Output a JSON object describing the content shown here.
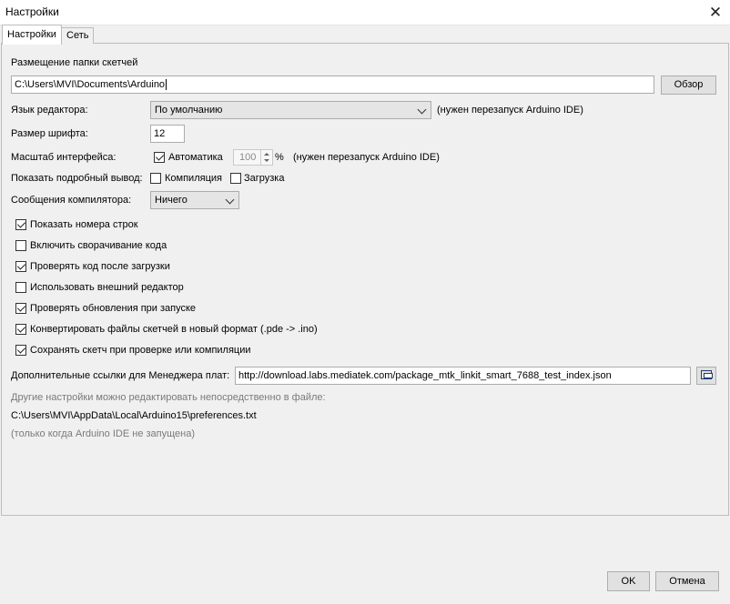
{
  "window": {
    "title": "Настройки",
    "close_glyph": "✕"
  },
  "tabs": [
    {
      "label": "Настройки",
      "active": true
    },
    {
      "label": "Сеть",
      "active": false
    }
  ],
  "sketchbook": {
    "label": "Размещение папки скетчей",
    "path": "C:\\Users\\MVI\\Documents\\Arduino",
    "browse_label": "Обзор"
  },
  "editor_language": {
    "label": "Язык редактора:",
    "value": "По умолчанию",
    "note": "(нужен перезапуск Arduino IDE)"
  },
  "font_size": {
    "label": "Размер шрифта:",
    "value": "12"
  },
  "interface_scale": {
    "label": "Масштаб интерфейса:",
    "auto_label": "Автоматика",
    "auto_checked": true,
    "value": "100",
    "percent": "%",
    "note": "(нужен перезапуск Arduino IDE)"
  },
  "verbose_output": {
    "label": "Показать подробный вывод:",
    "compile_label": "Компиляция",
    "compile_checked": false,
    "upload_label": "Загрузка",
    "upload_checked": false
  },
  "compiler_warnings": {
    "label": "Сообщения компилятора:",
    "value": "Ничего"
  },
  "options": [
    {
      "label": "Показать номера строк",
      "checked": true
    },
    {
      "label": "Включить сворачивание кода",
      "checked": false
    },
    {
      "label": "Проверять код после загрузки",
      "checked": true
    },
    {
      "label": "Использовать внешний редактор",
      "checked": false
    },
    {
      "label": "Проверять обновления при запуске",
      "checked": true
    },
    {
      "label": "Конвертировать файлы скетчей в новый формат (.pde -> .ino)",
      "checked": true
    },
    {
      "label": "Сохранять скетч при проверке или компиляции",
      "checked": true
    }
  ],
  "board_urls": {
    "label": "Дополнительные ссылки для Менеджера плат:",
    "value": "http://download.labs.mediatek.com/package_mtk_linkit_smart_7688_test_index.json"
  },
  "footer_info": {
    "hint": "Другие настройки можно редактировать непосредственно в файле:",
    "prefs_path": "C:\\Users\\MVI\\AppData\\Local\\Arduino15\\preferences.txt",
    "hint2": "(только когда Arduino IDE не запущена)"
  },
  "buttons": {
    "ok": "OK",
    "cancel": "Отмена"
  }
}
